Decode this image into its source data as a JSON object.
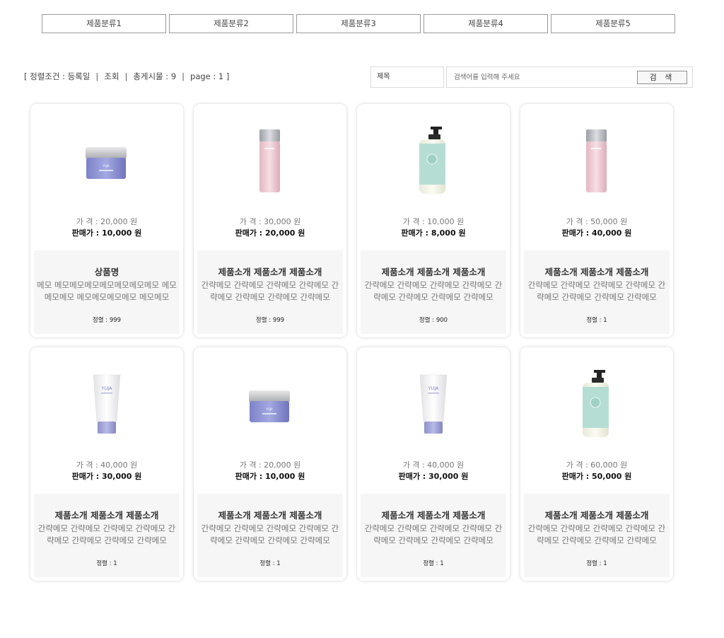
{
  "categories": [
    "제품분류1",
    "제품분류2",
    "제품분류3",
    "제품분류4",
    "제품분류5"
  ],
  "sort_bar": {
    "condition": "[ 정렬조건 : 등록일",
    "query_link": "조회",
    "total": "총게시물 : 9",
    "page": "page : 1 ]"
  },
  "search": {
    "field": "제목",
    "placeholder": "검색어를 입력해 주세요",
    "button": "검 색"
  },
  "colors": {
    "card_info_bg": "#f6f6f6",
    "border": "#9a9a9a"
  },
  "products": [
    {
      "image": "cream-jar-purple",
      "price": "가  격 : 20,000 원",
      "sale_price": "판매가 : 10,000 원",
      "name": "상품명",
      "memo": "메모 메모메모메모메모메모메모메모 메모메모메모 메모메모메모메모 메모메모",
      "order": "정렬 : 999"
    },
    {
      "image": "pink-bottle",
      "price": "가  격 : 30,000 원",
      "sale_price": "판매가 : 20,000 원",
      "name": "제품소개 제품소개 제품소개",
      "memo": "간략메모 간략메모 간략메모 간략메모 간략메모 간략메모 간략메모 간략메모",
      "order": "정렬 : 999"
    },
    {
      "image": "pump-bottle-mint",
      "price": "가  격 : 10,000 원",
      "sale_price": "판매가 : 8,000 원",
      "name": "제품소개 제품소개 제품소개",
      "memo": "간략메모 간략메모 간략메모 간략메모 간략메모 간략메모 간략메모 간략메모",
      "order": "정렬 : 900"
    },
    {
      "image": "pink-bottle",
      "price": "가  격 : 50,000 원",
      "sale_price": "판매가 : 40,000 원",
      "name": "제품소개 제품소개 제품소개",
      "memo": "간략메모 간략메모 간략메모 간략메모 간략메모 간략메모 간략메모 간략메모",
      "order": "정렬 : 1"
    },
    {
      "image": "tube-white",
      "price": "가  격 : 40,000 원",
      "sale_price": "판매가 : 30,000 원",
      "name": "제품소개 제품소개 제품소개",
      "memo": "간략메모 간략메모 간략메모 간략메모 간략메모 간략메모 간략메모 간략메모",
      "order": "정렬 : 1"
    },
    {
      "image": "cream-jar-purple",
      "price": "가  격 : 20,000 원",
      "sale_price": "판매가 : 10,000 원",
      "name": "제품소개 제품소개 제품소개",
      "memo": "간략메모 간략메모 간략메모 간략메모 간략메모 간략메모 간략메모 간략메모",
      "order": "정렬 : 1"
    },
    {
      "image": "tube-white",
      "price": "가  격 : 40,000 원",
      "sale_price": "판매가 : 30,000 원",
      "name": "제품소개 제품소개 제품소개",
      "memo": "간략메모 간략메모 간략메모 간략메모 간략메모 간략메모 간략메모 간략메모",
      "order": "정렬 : 1"
    },
    {
      "image": "pump-bottle-mint",
      "price": "가  격 : 60,000 원",
      "sale_price": "판매가 : 50,000 원",
      "name": "제품소개 제품소개 제품소개",
      "memo": "간략메모 간략메모 간략메모 간략메모 간략메모 간략메모 간략메모 간략메모",
      "order": "정렬 : 1"
    }
  ]
}
